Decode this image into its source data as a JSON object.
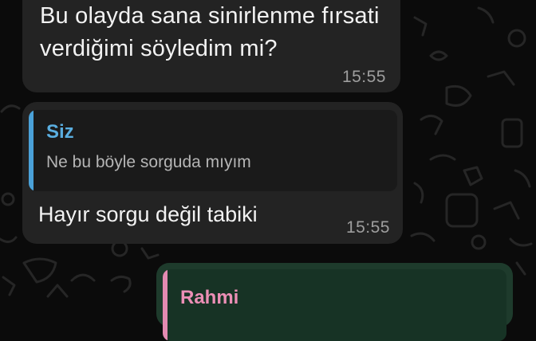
{
  "messages": [
    {
      "direction": "incoming",
      "text": "Bu olayda sana sinirlenme fırsati verdiğimi söyledim mi?",
      "time": "15:55"
    },
    {
      "direction": "incoming",
      "quote": {
        "author": "Siz",
        "text": "Ne bu böyle sorguda mıyım",
        "color": "#5aaee0"
      },
      "text": "Hayır sorgu değil tabiki",
      "time": "15:55"
    },
    {
      "direction": "outgoing",
      "quote": {
        "author": "Rahmi",
        "color": "#ec8fb6"
      }
    }
  ],
  "colors": {
    "background": "#0b0b0b",
    "incoming_bubble": "#232323",
    "outgoing_bubble": "#1e3b2c"
  }
}
